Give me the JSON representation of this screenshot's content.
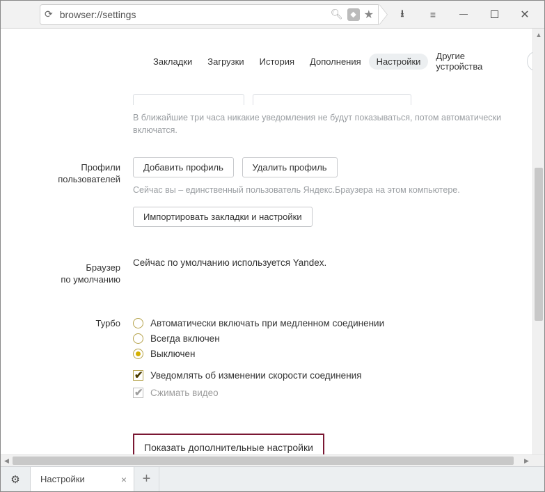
{
  "chrome": {
    "url": "browser://settings"
  },
  "nav": {
    "bookmarks": "Закладки",
    "downloads": "Загрузки",
    "history": "История",
    "addons": "Дополнения",
    "settings": "Настройки",
    "other_devices": "Другие устройства"
  },
  "notifications": {
    "hint": "В ближайшие три часа никакие уведомления не будут показываться, потом автоматически включатся."
  },
  "profiles": {
    "label_l1": "Профили",
    "label_l2": "пользователей",
    "add": "Добавить профиль",
    "remove": "Удалить профиль",
    "hint": "Сейчас вы – единственный пользователь Яндекс.Браузера на этом компьютере.",
    "import": "Импортировать закладки и настройки"
  },
  "default_browser": {
    "label_l1": "Браузер",
    "label_l2": "по умолчанию",
    "text": "Сейчас по умолчанию используется Yandex."
  },
  "turbo": {
    "label": "Турбо",
    "auto": "Автоматически включать при медленном соединении",
    "always": "Всегда включен",
    "off": "Выключен",
    "notify": "Уведомлять об изменении скорости соединения",
    "compress": "Сжимать видео"
  },
  "show_more": "Показать дополнительные настройки",
  "tab": {
    "title": "Настройки"
  }
}
